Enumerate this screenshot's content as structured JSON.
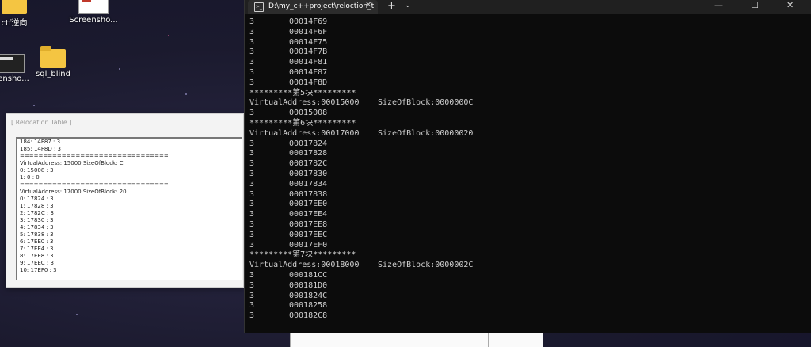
{
  "desktop": {
    "icons": [
      {
        "label": "ctf逆向",
        "kind": "folder"
      },
      {
        "label": "Screensho...",
        "kind": "thumb"
      },
      {
        "label": "reensho...",
        "kind": "thumb-dark"
      },
      {
        "label": "sql_blind",
        "kind": "folder"
      }
    ]
  },
  "reloc_window": {
    "title": "[ Relocation Table ]",
    "lines": [
      "184: 14F87 : 3",
      "185: 14F8D : 3",
      "================================",
      "VirtualAddress: 15000 SizeOfBlock: C",
      "0: 15008 : 3",
      "1: 0 : 0",
      "================================",
      "VirtualAddress: 17000 SizeOfBlock: 20",
      "0: 17824 : 3",
      "1: 17828 : 3",
      "2: 1782C : 3",
      "3: 17830 : 3",
      "4: 17834 : 3",
      "5: 17838 : 3",
      "6: 17EE0 : 3",
      "7: 17EE4 : 3",
      "8: 17EE8 : 3",
      "9: 17EEC : 3",
      "10: 17EF0 : 3"
    ]
  },
  "terminal": {
    "tab_title": "D:\\my_c++project\\reloction_t",
    "tab_close_glyph": "✕",
    "add_tab_glyph": "+",
    "dropdown_glyph": "⌄",
    "minimize_glyph": "—",
    "maximize_glyph": "☐",
    "close_glyph": "✕",
    "lines": [
      {
        "t": "entry",
        "a": "3",
        "b": "00014F69"
      },
      {
        "t": "entry",
        "a": "3",
        "b": "00014F6F"
      },
      {
        "t": "entry",
        "a": "3",
        "b": "00014F75"
      },
      {
        "t": "entry",
        "a": "3",
        "b": "00014F7B"
      },
      {
        "t": "entry",
        "a": "3",
        "b": "00014F81"
      },
      {
        "t": "entry",
        "a": "3",
        "b": "00014F87"
      },
      {
        "t": "entry",
        "a": "3",
        "b": "00014F8D"
      },
      {
        "t": "header",
        "text": "*********第5块*********"
      },
      {
        "t": "va",
        "a": "VirtualAddress:00015000",
        "b": "SizeOfBlock:0000000C"
      },
      {
        "t": "entry",
        "a": "3",
        "b": "00015008"
      },
      {
        "t": "header",
        "text": "*********第6块*********"
      },
      {
        "t": "va",
        "a": "VirtualAddress:00017000",
        "b": "SizeOfBlock:00000020"
      },
      {
        "t": "entry",
        "a": "3",
        "b": "00017824"
      },
      {
        "t": "entry",
        "a": "3",
        "b": "00017828"
      },
      {
        "t": "entry",
        "a": "3",
        "b": "0001782C"
      },
      {
        "t": "entry",
        "a": "3",
        "b": "00017830"
      },
      {
        "t": "entry",
        "a": "3",
        "b": "00017834"
      },
      {
        "t": "entry",
        "a": "3",
        "b": "00017838"
      },
      {
        "t": "entry",
        "a": "3",
        "b": "00017EE0"
      },
      {
        "t": "entry",
        "a": "3",
        "b": "00017EE4"
      },
      {
        "t": "entry",
        "a": "3",
        "b": "00017EE8"
      },
      {
        "t": "entry",
        "a": "3",
        "b": "00017EEC"
      },
      {
        "t": "entry",
        "a": "3",
        "b": "00017EF0"
      },
      {
        "t": "header",
        "text": "*********第7块*********"
      },
      {
        "t": "va",
        "a": "VirtualAddress:00018000",
        "b": "SizeOfBlock:0000002C"
      },
      {
        "t": "entry",
        "a": "3",
        "b": "000181CC"
      },
      {
        "t": "entry",
        "a": "3",
        "b": "000181D0"
      },
      {
        "t": "entry",
        "a": "3",
        "b": "0001824C"
      },
      {
        "t": "entry",
        "a": "3",
        "b": "00018258"
      },
      {
        "t": "entry",
        "a": "3",
        "b": "000182C8"
      }
    ]
  }
}
